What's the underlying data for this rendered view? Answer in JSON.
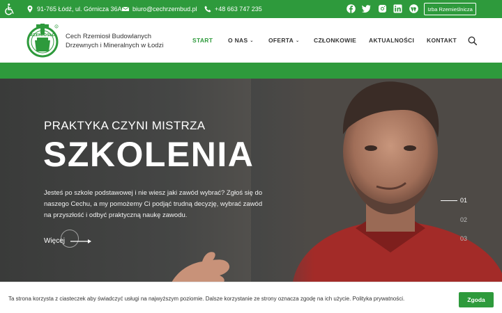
{
  "topbar": {
    "address": "91-765 Łódź, ul. Górnicza 36A",
    "email": "biuro@cechrzembud.pl",
    "phone": "+48 663 747 235",
    "social_icons": [
      "facebook-icon",
      "twitter-icon",
      "instagram-icon",
      "linkedin-icon",
      "wordpress-icon"
    ],
    "izba_button": "Izba Rzemieślnicza"
  },
  "header": {
    "logo_text": "RZEMIOSŁO",
    "brand_line1": "Cech Rzemiosł Budowlanych",
    "brand_line2": "Drzewnych i Mineralnych w Łodzi",
    "nav": [
      {
        "label": "START"
      },
      {
        "label": "O NAS"
      },
      {
        "label": "OFERTA"
      },
      {
        "label": "CZŁONKOWIE"
      },
      {
        "label": "AKTUALNOŚCI"
      },
      {
        "label": "KONTAKT"
      }
    ]
  },
  "hero": {
    "subtitle": "PRAKTYKA CZYNI MISTRZA",
    "title": "SZKOLENIA",
    "text": "Jesteś po szkole podstawowej i nie wiesz jaki zawód wybrać? Zgłoś się do naszego Cechu, a my pomożemy Ci podjąć trudną decyzję, wybrać zawód na przyszłość i odbyć praktyczną naukę zawodu.",
    "more_label": "Więcej",
    "slides": [
      "01",
      "02",
      "03"
    ]
  },
  "cookie": {
    "text": "Ta strona korzysta z ciasteczek aby świadczyć usługi na najwyższym poziomie. Dalsze korzystanie ze strony oznacza zgodę na ich użycie. Polityka prywatności.",
    "button": "Zgoda"
  },
  "colors": {
    "accent": "#2e9a3c"
  }
}
